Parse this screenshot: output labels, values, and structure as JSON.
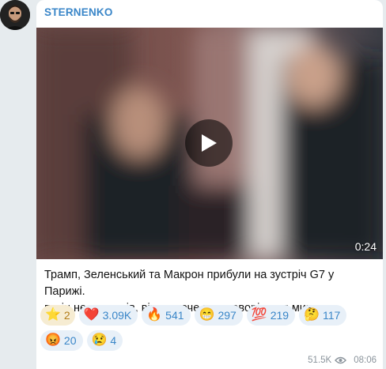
{
  "channel": {
    "name": "STERNENKO"
  },
  "video": {
    "duration": "0:24"
  },
  "post": {
    "text_line1": "Трамп, Зеленський та Макрон прибули на зустріч G7 у Парижі.",
    "text_line2": "путін не прилетів, він не хоче переговорів для миру."
  },
  "reactions_row1": [
    {
      "emoji": "⭐",
      "count": "2",
      "type": "star"
    },
    {
      "emoji": "❤️",
      "count": "3.09K"
    },
    {
      "emoji": "🔥",
      "count": "541"
    },
    {
      "emoji": "😁",
      "count": "297"
    },
    {
      "emoji": "💯",
      "count": "219"
    },
    {
      "emoji": "🤔",
      "count": "117"
    }
  ],
  "reactions_row2": [
    {
      "emoji": "😡",
      "count": "20"
    },
    {
      "emoji": "😢",
      "count": "4"
    }
  ],
  "meta": {
    "views": "51.5K",
    "time": "08:06",
    "icon": "eye-icon"
  },
  "colors": {
    "accent": "#3a86c8",
    "bubble": "#ffffff",
    "background": "#e6ebee"
  }
}
